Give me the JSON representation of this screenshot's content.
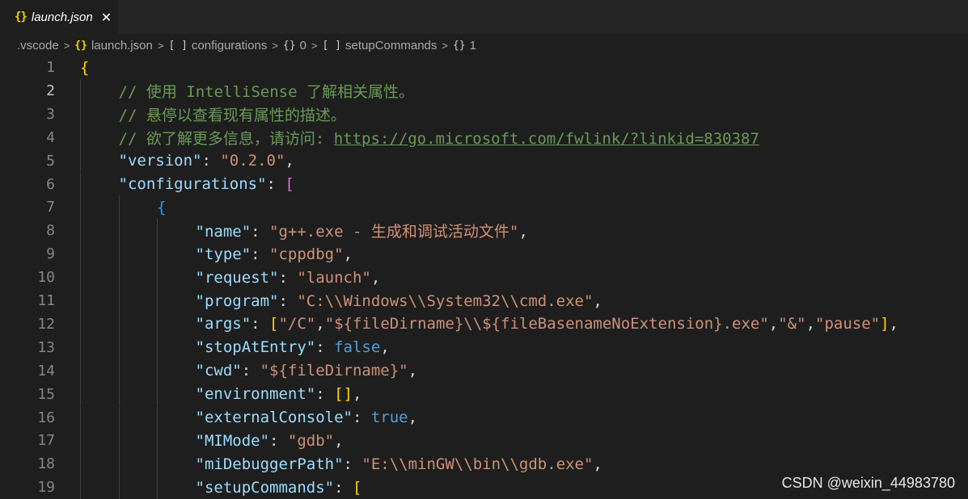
{
  "tab": {
    "icon": "json-braces-icon",
    "label": "launch.json",
    "close": "✕"
  },
  "breadcrumb": [
    {
      "icon": "",
      "label": ".vscode"
    },
    {
      "icon": "{}",
      "label": "launch.json"
    },
    {
      "icon": "[ ]",
      "label": "configurations"
    },
    {
      "icon": "{}",
      "label": "0"
    },
    {
      "icon": "[ ]",
      "label": "setupCommands"
    },
    {
      "icon": "{}",
      "label": "1"
    }
  ],
  "breadcrumb_separator": ">",
  "lines": [
    {
      "n": "1",
      "indent": 0,
      "tokens": [
        {
          "t": "{",
          "c": "b1"
        }
      ]
    },
    {
      "n": "2",
      "indent": 1,
      "tokens": [
        {
          "t": "// 使用 IntelliSense 了解相关属性。",
          "c": "t-com"
        }
      ]
    },
    {
      "n": "3",
      "indent": 1,
      "tokens": [
        {
          "t": "// 悬停以查看现有属性的描述。",
          "c": "t-com"
        }
      ]
    },
    {
      "n": "4",
      "indent": 1,
      "tokens": [
        {
          "t": "// 欲了解更多信息，请访问: ",
          "c": "t-com"
        },
        {
          "t": "https://go.microsoft.com/fwlink/?linkid=830387",
          "c": "t-link"
        }
      ]
    },
    {
      "n": "5",
      "indent": 1,
      "tokens": [
        {
          "t": "\"version\"",
          "c": "t-key"
        },
        {
          "t": ": ",
          "c": "t-punc"
        },
        {
          "t": "\"0.2.0\"",
          "c": "t-str"
        },
        {
          "t": ",",
          "c": "t-punc"
        }
      ]
    },
    {
      "n": "6",
      "indent": 1,
      "tokens": [
        {
          "t": "\"configurations\"",
          "c": "t-key"
        },
        {
          "t": ": ",
          "c": "t-punc"
        },
        {
          "t": "[",
          "c": "b2"
        }
      ]
    },
    {
      "n": "7",
      "indent": 2,
      "tokens": [
        {
          "t": "{",
          "c": "b3"
        }
      ]
    },
    {
      "n": "8",
      "indent": 3,
      "tokens": [
        {
          "t": "\"name\"",
          "c": "t-key"
        },
        {
          "t": ": ",
          "c": "t-punc"
        },
        {
          "t": "\"g++.exe - 生成和调试活动文件\"",
          "c": "t-str"
        },
        {
          "t": ",",
          "c": "t-punc"
        }
      ]
    },
    {
      "n": "9",
      "indent": 3,
      "tokens": [
        {
          "t": "\"type\"",
          "c": "t-key"
        },
        {
          "t": ": ",
          "c": "t-punc"
        },
        {
          "t": "\"cppdbg\"",
          "c": "t-str"
        },
        {
          "t": ",",
          "c": "t-punc"
        }
      ]
    },
    {
      "n": "10",
      "indent": 3,
      "tokens": [
        {
          "t": "\"request\"",
          "c": "t-key"
        },
        {
          "t": ": ",
          "c": "t-punc"
        },
        {
          "t": "\"launch\"",
          "c": "t-str"
        },
        {
          "t": ",",
          "c": "t-punc"
        }
      ]
    },
    {
      "n": "11",
      "indent": 3,
      "tokens": [
        {
          "t": "\"program\"",
          "c": "t-key"
        },
        {
          "t": ": ",
          "c": "t-punc"
        },
        {
          "t": "\"C:\\\\Windows\\\\System32\\\\cmd.exe\"",
          "c": "t-str"
        },
        {
          "t": ",",
          "c": "t-punc"
        }
      ]
    },
    {
      "n": "12",
      "indent": 3,
      "tokens": [
        {
          "t": "\"args\"",
          "c": "t-key"
        },
        {
          "t": ": ",
          "c": "t-punc"
        },
        {
          "t": "[",
          "c": "b1"
        },
        {
          "t": "\"/C\"",
          "c": "t-str"
        },
        {
          "t": ",",
          "c": "t-punc"
        },
        {
          "t": "\"${fileDirname}\\\\${fileBasenameNoExtension}.exe\"",
          "c": "t-str"
        },
        {
          "t": ",",
          "c": "t-punc"
        },
        {
          "t": "\"&\"",
          "c": "t-str"
        },
        {
          "t": ",",
          "c": "t-punc"
        },
        {
          "t": "\"pause\"",
          "c": "t-str"
        },
        {
          "t": "]",
          "c": "b1"
        },
        {
          "t": ",",
          "c": "t-punc"
        }
      ]
    },
    {
      "n": "13",
      "indent": 3,
      "tokens": [
        {
          "t": "\"stopAtEntry\"",
          "c": "t-key"
        },
        {
          "t": ": ",
          "c": "t-punc"
        },
        {
          "t": "false",
          "c": "t-bool"
        },
        {
          "t": ",",
          "c": "t-punc"
        }
      ]
    },
    {
      "n": "14",
      "indent": 3,
      "tokens": [
        {
          "t": "\"cwd\"",
          "c": "t-key"
        },
        {
          "t": ": ",
          "c": "t-punc"
        },
        {
          "t": "\"${fileDirname}\"",
          "c": "t-str"
        },
        {
          "t": ",",
          "c": "t-punc"
        }
      ]
    },
    {
      "n": "15",
      "indent": 3,
      "tokens": [
        {
          "t": "\"environment\"",
          "c": "t-key"
        },
        {
          "t": ": ",
          "c": "t-punc"
        },
        {
          "t": "[]",
          "c": "b1"
        },
        {
          "t": ",",
          "c": "t-punc"
        }
      ]
    },
    {
      "n": "16",
      "indent": 3,
      "tokens": [
        {
          "t": "\"externalConsole\"",
          "c": "t-key"
        },
        {
          "t": ": ",
          "c": "t-punc"
        },
        {
          "t": "true",
          "c": "t-bool"
        },
        {
          "t": ",",
          "c": "t-punc"
        }
      ]
    },
    {
      "n": "17",
      "indent": 3,
      "tokens": [
        {
          "t": "\"MIMode\"",
          "c": "t-key"
        },
        {
          "t": ": ",
          "c": "t-punc"
        },
        {
          "t": "\"gdb\"",
          "c": "t-str"
        },
        {
          "t": ",",
          "c": "t-punc"
        }
      ]
    },
    {
      "n": "18",
      "indent": 3,
      "tokens": [
        {
          "t": "\"miDebuggerPath\"",
          "c": "t-key"
        },
        {
          "t": ": ",
          "c": "t-punc"
        },
        {
          "t": "\"E:\\\\minGW\\\\bin\\\\gdb.exe\"",
          "c": "t-str"
        },
        {
          "t": ",",
          "c": "t-punc"
        }
      ]
    },
    {
      "n": "19",
      "indent": 3,
      "tokens": [
        {
          "t": "\"setupCommands\"",
          "c": "t-key"
        },
        {
          "t": ": ",
          "c": "t-punc"
        },
        {
          "t": "[",
          "c": "b1"
        }
      ]
    }
  ],
  "watermark": "CSDN @weixin_44983780",
  "colors": {
    "background": "#1e1e1e",
    "key": "#9cdcfe",
    "string": "#ce9178",
    "comment": "#6a9955",
    "boolean": "#569cd6",
    "bracket_level_1": "#ffd700",
    "bracket_level_2": "#da70d6",
    "bracket_level_3": "#179fff"
  }
}
